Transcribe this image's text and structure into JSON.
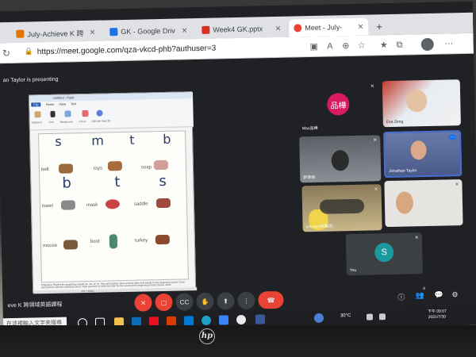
{
  "browser": {
    "tabs": [
      {
        "label": "July-Achieve K 跨",
        "color": "#e37400"
      },
      {
        "label": "GK - Google Driv",
        "color": "#1a73e8"
      },
      {
        "label": "Week4 GK.pptx",
        "color": "#d93025"
      },
      {
        "label": "Meet - July-",
        "color": "#ea4335"
      }
    ],
    "new_tab": "+",
    "url": "https://meet.google.com/qza-vkcd-phb?authuser=3"
  },
  "meet": {
    "presenting_label": "an Taylor is presenting",
    "participants": [
      {
        "name": "Max品樺",
        "initials": "品樺",
        "avatar_color": "#d81b60"
      },
      {
        "name": "Eva Zeng"
      },
      {
        "name": "許琬栩"
      },
      {
        "name": "Jonathan Taylor"
      },
      {
        "name": "Linxian(林瑀欣)"
      },
      {
        "name": ""
      },
      {
        "name": "You",
        "initials": "S",
        "avatar_color": "#1a9aa0"
      }
    ],
    "meeting_name": "eve K 跨領域英語課程",
    "participant_count": "8"
  },
  "slide": {
    "paint_title": "Untitled - Paint",
    "paint_tabs": [
      "File",
      "Home",
      "View",
      "Text"
    ],
    "ribbon_labels": [
      "Clipboard",
      "Font",
      "Background",
      "Colors",
      "Edit with Paint 3D"
    ],
    "letters_top": [
      "s",
      "m",
      "t",
      "b"
    ],
    "letters_mid": [
      "b",
      "t",
      "s"
    ],
    "words": [
      "belt",
      "toys",
      "soap",
      "towel",
      "mask",
      "saddle",
      "moose",
      "boot",
      "turkey"
    ],
    "footer": "Directions: Review the beginning sounds /b/, /m/, /t/, /s/. Say each picture name and the letter that stands for the beginning sound. Circle each picture with the matching sound. Then ask them to write the letter for the sound at the beginning of each picture name.",
    "status": "476 × 360px"
  },
  "taskbar": {
    "search_placeholder": "在這裡輸入文字來搜尋",
    "temperature": "30°C",
    "time": "下午 09:07",
    "date": "2021/7/30"
  },
  "colors": {
    "meet_bg": "#202124",
    "hangup": "#ea4335",
    "tab_bar": "#dfe1e5"
  }
}
